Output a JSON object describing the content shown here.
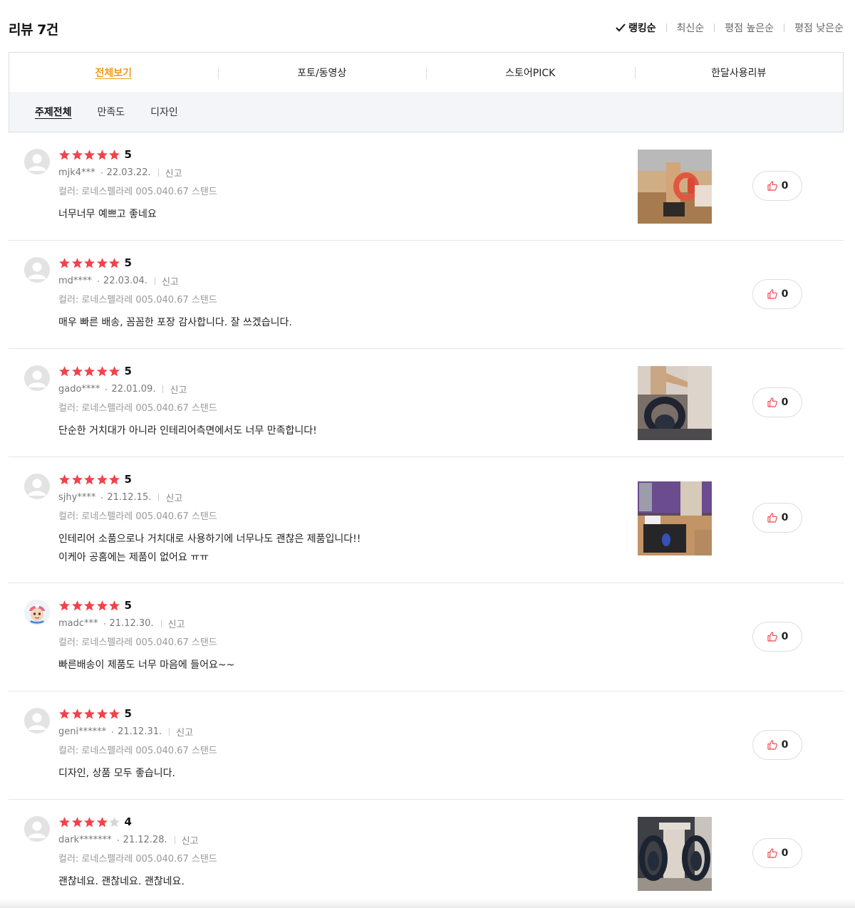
{
  "header": {
    "title": "리뷰 7건",
    "sort": [
      "랭킹순",
      "최신순",
      "평점 높은순",
      "평점 낮은순"
    ]
  },
  "tabs": [
    "전체보기",
    "포토/동영상",
    "스토어PICK",
    "한달사용리뷰"
  ],
  "topics": [
    "주제전체",
    "만족도",
    "디자인"
  ],
  "colors": {
    "star": "#f0434b",
    "accent": "#f09b1a",
    "like": "#f0434b"
  },
  "reviews": [
    {
      "score": "5",
      "rating": 5,
      "user": "mjk4***",
      "date": "22.03.22.",
      "report": "신고",
      "option": "컬러: 로네스펠라레 005.040.67 스탠드",
      "text": [
        "너무너무 예쁘고 좋네요"
      ],
      "likes": "0",
      "has_photo": true
    },
    {
      "score": "5",
      "rating": 5,
      "user": "md****",
      "date": "22.03.04.",
      "report": "신고",
      "option": "컬러: 로네스펠라레 005.040.67 스탠드",
      "text": [
        "매우 빠른 배송, 꼼꼼한 포장 감사합니다. 잘 쓰겠습니다."
      ],
      "likes": "0",
      "has_photo": false
    },
    {
      "score": "5",
      "rating": 5,
      "user": "gado****",
      "date": "22.01.09.",
      "report": "신고",
      "option": "컬러: 로네스펠라레 005.040.67 스탠드",
      "text": [
        "단순한 거치대가 아니라 인테리어측면에서도 너무 만족합니다!"
      ],
      "likes": "0",
      "has_photo": true
    },
    {
      "score": "5",
      "rating": 5,
      "user": "sjhy****",
      "date": "21.12.15.",
      "report": "신고",
      "option": "컬러: 로네스펠라레 005.040.67 스탠드",
      "text": [
        "인테리어 소품으로나 거치대로 사용하기에 너무나도 괜찮은 제품입니다!!",
        "이케아 공홈에는 제품이 없어요 ㅠㅠ"
      ],
      "likes": "0",
      "has_photo": true
    },
    {
      "score": "5",
      "rating": 5,
      "user": "madc***",
      "date": "21.12.30.",
      "report": "신고",
      "option": "컬러: 로네스펠라레 005.040.67 스탠드",
      "text": [
        "빠른배송이 제품도 너무 마음에 들어요~~"
      ],
      "likes": "0",
      "has_photo": false
    },
    {
      "score": "5",
      "rating": 5,
      "user": "geni******",
      "date": "21.12.31.",
      "report": "신고",
      "option": "컬러: 로네스펠라레 005.040.67 스탠드",
      "text": [
        "디자인, 상품 모두 좋습니다."
      ],
      "likes": "0",
      "has_photo": false
    },
    {
      "score": "4",
      "rating": 4,
      "user": "dark*******",
      "date": "21.12.28.",
      "report": "신고",
      "option": "컬러: 로네스펠라레 005.040.67 스탠드",
      "text": [
        "괜찮네요. 괜찮네요. 괜찮네요."
      ],
      "likes": "0",
      "has_photo": true
    }
  ]
}
